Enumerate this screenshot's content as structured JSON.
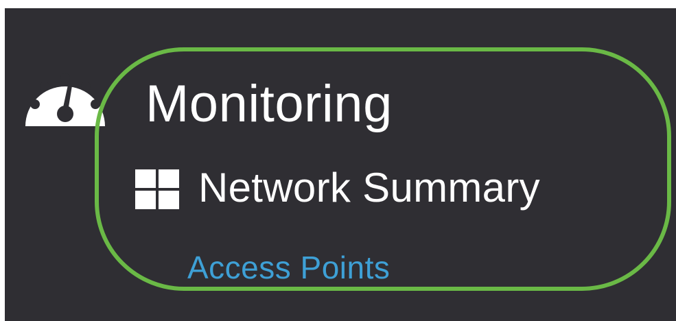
{
  "nav": {
    "monitoring": {
      "label": "Monitoring",
      "icon": "dashboard-gauge-icon"
    },
    "submenu": [
      {
        "label": "Network Summary",
        "icon": "grid-icon",
        "color": "#ffffff"
      },
      {
        "label": "Access Points",
        "color": "#3ea0d6"
      }
    ]
  },
  "colors": {
    "background": "#2f2e33",
    "highlight": "#6ab946",
    "text": "#ffffff",
    "link": "#3ea0d6"
  }
}
